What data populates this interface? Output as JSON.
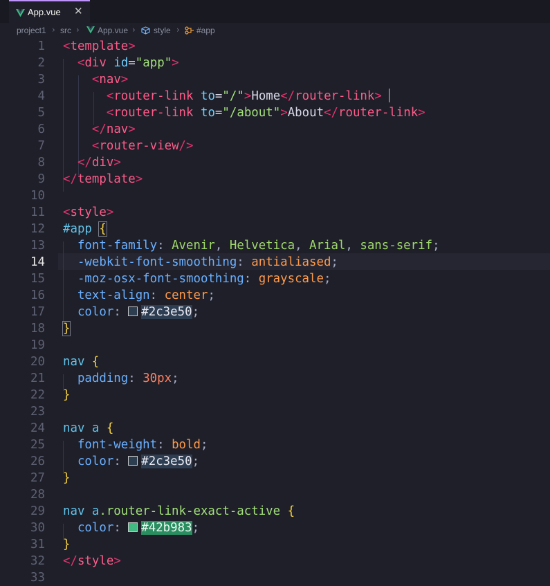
{
  "tab": {
    "label": "App.vue",
    "close": "✕"
  },
  "breadcrumb": [
    "project1",
    "src",
    "App.vue",
    "style",
    "#app"
  ],
  "active_line": 14,
  "colors": {
    "swatch_dark": "#2c3e50",
    "swatch_green": "#42b983",
    "vue_green": "#41b883"
  },
  "lines": [
    [
      [
        "p",
        "<"
      ],
      [
        "t",
        "template"
      ],
      [
        "p",
        ">"
      ]
    ],
    [
      [
        "c",
        "  "
      ],
      [
        "p",
        "<"
      ],
      [
        "t",
        "div"
      ],
      [
        "c",
        " "
      ],
      [
        "a",
        "id"
      ],
      [
        "c",
        "="
      ],
      [
        "s",
        "\""
      ],
      [
        "s",
        "app"
      ],
      [
        "s",
        "\""
      ],
      [
        "p",
        ">"
      ]
    ],
    [
      [
        "c",
        "    "
      ],
      [
        "p",
        "<"
      ],
      [
        "t",
        "nav"
      ],
      [
        "p",
        ">"
      ]
    ],
    [
      [
        "c",
        "      "
      ],
      [
        "p",
        "<"
      ],
      [
        "t",
        "router-link"
      ],
      [
        "c",
        " "
      ],
      [
        "a",
        "to"
      ],
      [
        "c",
        "="
      ],
      [
        "s",
        "\""
      ],
      [
        "s",
        "/"
      ],
      [
        "s",
        "\""
      ],
      [
        "p",
        ">"
      ],
      [
        "c",
        "Home"
      ],
      [
        "p",
        "</"
      ],
      [
        "t",
        "router-link"
      ],
      [
        "p",
        ">"
      ],
      [
        "c",
        " "
      ],
      [
        "cursor",
        ""
      ]
    ],
    [
      [
        "c",
        "      "
      ],
      [
        "p",
        "<"
      ],
      [
        "t",
        "router-link"
      ],
      [
        "c",
        " "
      ],
      [
        "a",
        "to"
      ],
      [
        "c",
        "="
      ],
      [
        "s",
        "\""
      ],
      [
        "s",
        "/about"
      ],
      [
        "s",
        "\""
      ],
      [
        "p",
        ">"
      ],
      [
        "c",
        "About"
      ],
      [
        "p",
        "</"
      ],
      [
        "t",
        "router-link"
      ],
      [
        "p",
        ">"
      ]
    ],
    [
      [
        "c",
        "    "
      ],
      [
        "p",
        "</"
      ],
      [
        "t",
        "nav"
      ],
      [
        "p",
        ">"
      ]
    ],
    [
      [
        "c",
        "    "
      ],
      [
        "p",
        "<"
      ],
      [
        "t",
        "router-view"
      ],
      [
        "p",
        "/>"
      ]
    ],
    [
      [
        "c",
        "  "
      ],
      [
        "p",
        "</"
      ],
      [
        "t",
        "div"
      ],
      [
        "p",
        ">"
      ]
    ],
    [
      [
        "p",
        "</"
      ],
      [
        "t",
        "template"
      ],
      [
        "p",
        ">"
      ]
    ],
    [],
    [
      [
        "p",
        "<"
      ],
      [
        "t",
        "style"
      ],
      [
        "p",
        ">"
      ]
    ],
    [
      [
        "sel",
        "#app"
      ],
      [
        "c",
        " "
      ],
      [
        "brbox",
        "{"
      ]
    ],
    [
      [
        "c",
        "  "
      ],
      [
        "prop",
        "font-family"
      ],
      [
        "col",
        ": "
      ],
      [
        "vg",
        "Avenir"
      ],
      [
        "col",
        ", "
      ],
      [
        "vg",
        "Helvetica"
      ],
      [
        "col",
        ", "
      ],
      [
        "vg",
        "Arial"
      ],
      [
        "col",
        ", "
      ],
      [
        "vg",
        "sans-serif"
      ],
      [
        "col",
        ";"
      ]
    ],
    [
      [
        "c",
        "  "
      ],
      [
        "prop",
        "-webkit-font-smoothing"
      ],
      [
        "col",
        ": "
      ],
      [
        "val",
        "antialiased"
      ],
      [
        "col",
        ";"
      ]
    ],
    [
      [
        "c",
        "  "
      ],
      [
        "prop",
        "-moz-osx-font-smoothing"
      ],
      [
        "col",
        ": "
      ],
      [
        "val",
        "grayscale"
      ],
      [
        "col",
        ";"
      ]
    ],
    [
      [
        "c",
        "  "
      ],
      [
        "prop",
        "text-align"
      ],
      [
        "col",
        ": "
      ],
      [
        "val",
        "center"
      ],
      [
        "col",
        ";"
      ]
    ],
    [
      [
        "c",
        "  "
      ],
      [
        "prop",
        "color"
      ],
      [
        "col",
        ": "
      ],
      [
        "swatch",
        "#2c3e50"
      ],
      [
        "hex1",
        "#2c3e50"
      ],
      [
        "col",
        ";"
      ]
    ],
    [
      [
        "brbox",
        "}"
      ]
    ],
    [],
    [
      [
        "sel",
        "nav"
      ],
      [
        "c",
        " "
      ],
      [
        "br",
        "{"
      ]
    ],
    [
      [
        "c",
        "  "
      ],
      [
        "prop",
        "padding"
      ],
      [
        "col",
        ": "
      ],
      [
        "num",
        "30px"
      ],
      [
        "col",
        ";"
      ]
    ],
    [
      [
        "br",
        "}"
      ]
    ],
    [],
    [
      [
        "sel",
        "nav a"
      ],
      [
        "c",
        " "
      ],
      [
        "br",
        "{"
      ]
    ],
    [
      [
        "c",
        "  "
      ],
      [
        "prop",
        "font-weight"
      ],
      [
        "col",
        ": "
      ],
      [
        "val",
        "bold"
      ],
      [
        "col",
        ";"
      ]
    ],
    [
      [
        "c",
        "  "
      ],
      [
        "prop",
        "color"
      ],
      [
        "col",
        ": "
      ],
      [
        "swatch",
        "#2c3e50"
      ],
      [
        "hex1",
        "#2c3e50"
      ],
      [
        "col",
        ";"
      ]
    ],
    [
      [
        "br",
        "}"
      ]
    ],
    [],
    [
      [
        "sel",
        "nav a"
      ],
      [
        "s",
        ".router-link-exact-active"
      ],
      [
        "c",
        " "
      ],
      [
        "br",
        "{"
      ]
    ],
    [
      [
        "c",
        "  "
      ],
      [
        "prop",
        "color"
      ],
      [
        "col",
        ": "
      ],
      [
        "swatch",
        "#42b983"
      ],
      [
        "hex2",
        "#42b983"
      ],
      [
        "col",
        ";"
      ]
    ],
    [
      [
        "br",
        "}"
      ]
    ],
    [
      [
        "p",
        "</"
      ],
      [
        "t",
        "style"
      ],
      [
        "p",
        ">"
      ]
    ],
    []
  ]
}
